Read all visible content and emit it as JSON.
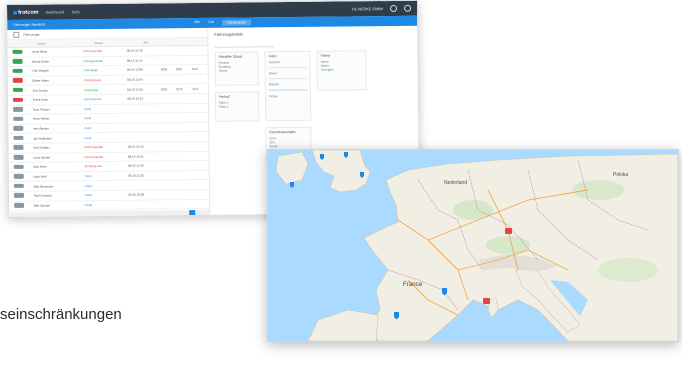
{
  "app": {
    "brand": "frotcom",
    "nav": [
      "Dashboard",
      "Tools"
    ],
    "user_chip": "DE WERKE GMBH",
    "bluebar_left": "Fahrzeuge Ubersicht",
    "bluebar_tabs": [
      "Alle",
      "Live",
      "Fahrtenbuch"
    ],
    "subheader_label": "Fahrzeuge",
    "table_headers": [
      "",
      "Name",
      "Status",
      "Zeit",
      "",
      "",
      ""
    ],
    "rows": [
      {
        "badge_color": "#36a852",
        "name": "Anna Meier",
        "status": "Fahrt beendet",
        "status_class": "st-red",
        "date": "08.10 14:30",
        "m": [
          "",
          "",
          ""
        ]
      },
      {
        "badge_color": "#36a852",
        "name": "Bernd Huber",
        "status": "Fahrt gestartet",
        "status_class": "st-green",
        "date": "08.10 14:12",
        "m": [
          "",
          "",
          ""
        ]
      },
      {
        "badge_color": "#36a852",
        "name": "Carl Wagner",
        "status": "Unterwegs",
        "status_class": "st-green",
        "date": "08.10 13:58",
        "m": [
          "1500",
          "80.0",
          "40.0"
        ]
      },
      {
        "badge_color": "#e04646",
        "name": "Dieter Maier",
        "status": "Zundung aus",
        "status_class": "st-red",
        "date": "08.10 13:44",
        "m": [
          "",
          "",
          ""
        ]
      },
      {
        "badge_color": "#36a852",
        "name": "Eva Schulz",
        "status": "Unterwegs",
        "status_class": "st-green",
        "date": "08.10 13:30",
        "m": [
          "1520",
          "82.0",
          "41.0"
        ]
      },
      {
        "badge_color": "#e04646",
        "name": "Frank Koch",
        "status": "Zundung aus",
        "status_class": "st-blue",
        "date": "08.10 13:12",
        "m": [
          "",
          "",
          ""
        ]
      },
      {
        "badge_color": "#8a959e",
        "name": "Gina Fischer",
        "status": "Parkt",
        "status_class": "st-blue",
        "date": "",
        "m": [
          "",
          "",
          ""
        ]
      },
      {
        "badge_color": "#8a959e",
        "name": "Hans Weber",
        "status": "Parkt",
        "status_class": "st-blue",
        "date": "",
        "m": [
          "",
          "",
          ""
        ]
      },
      {
        "badge_color": "#8a959e",
        "name": "Ines Becker",
        "status": "Parkt",
        "status_class": "st-blue",
        "date": "",
        "m": [
          "",
          "",
          ""
        ]
      },
      {
        "badge_color": "#8a959e",
        "name": "Jan Hoffmann",
        "status": "Parkt",
        "status_class": "st-blue",
        "date": "",
        "m": [
          "",
          "",
          ""
        ]
      },
      {
        "badge_color": "#8a959e",
        "name": "Karl Schafer",
        "status": "Fahrt beendet",
        "status_class": "st-red",
        "date": "08.10 12:10",
        "m": [
          "",
          "",
          ""
        ]
      },
      {
        "badge_color": "#8a959e",
        "name": "Lena Richter",
        "status": "Fahrt beendet",
        "status_class": "st-red",
        "date": "08.10 11:54",
        "m": [
          "",
          "",
          ""
        ]
      },
      {
        "badge_color": "#8a959e",
        "name": "Max Klein",
        "status": "Zundung aus",
        "status_class": "st-red",
        "date": "08.10 11:40",
        "m": [
          "",
          "",
          ""
        ]
      },
      {
        "badge_color": "#8a959e",
        "name": "Nina Wolf",
        "status": "Parkt",
        "status_class": "st-blue",
        "date": "08.10 11:20",
        "m": [
          "",
          "",
          ""
        ]
      },
      {
        "badge_color": "#8a959e",
        "name": "Otto Neumann",
        "status": "Parkt",
        "status_class": "st-blue",
        "date": "",
        "m": [
          "",
          "",
          ""
        ]
      },
      {
        "badge_color": "#8a959e",
        "name": "Paul Schwarz",
        "status": "Parkt",
        "status_class": "st-blue",
        "date": "08.10 10:58",
        "m": [
          "",
          "",
          ""
        ]
      },
      {
        "badge_color": "#8a959e",
        "name": "Rita Zimmer",
        "status": "Parkt",
        "status_class": "st-blue",
        "date": "",
        "m": [
          "",
          "",
          ""
        ]
      },
      {
        "badge_color": "#8a959e",
        "name": "Sven Kruger",
        "status": "Parkt",
        "status_class": "st-blue",
        "date": "",
        "m": [
          "",
          "",
          ""
        ]
      },
      {
        "badge_color": "#8a959e",
        "name": "Tom Hartmann",
        "status": "Parkt",
        "status_class": "st-blue",
        "date": "",
        "m": [
          "",
          "",
          ""
        ]
      }
    ],
    "right_title": "Fahrzeugdetails",
    "cards": [
      {
        "title": "Aktueller Status",
        "lines": [
          "Position",
          "Zundung",
          "Fahrer"
        ]
      },
      {
        "title": "Fahrt",
        "lines": [
          "Startzeit",
          "Dauer",
          "Distanz",
          "Tempo"
        ]
      },
      {
        "title": "Fahrer",
        "lines": [
          "Name",
          "Status"
        ],
        "ok": "Verfugbar"
      },
      {
        "title": "Verlauf",
        "lines": [
          "Fahrt 1",
          "Fahrt 2"
        ]
      },
      {
        "title": "Einschrankungen",
        "lines": [
          "Zone",
          "Zeit",
          "Route"
        ]
      }
    ]
  },
  "map": {
    "country_labels": [
      "Nederland",
      "France",
      "Polska"
    ],
    "marker_colors": {
      "vehicle": "#1e88e5",
      "alert": "#e04646"
    }
  },
  "caption": "seinschränkungen"
}
